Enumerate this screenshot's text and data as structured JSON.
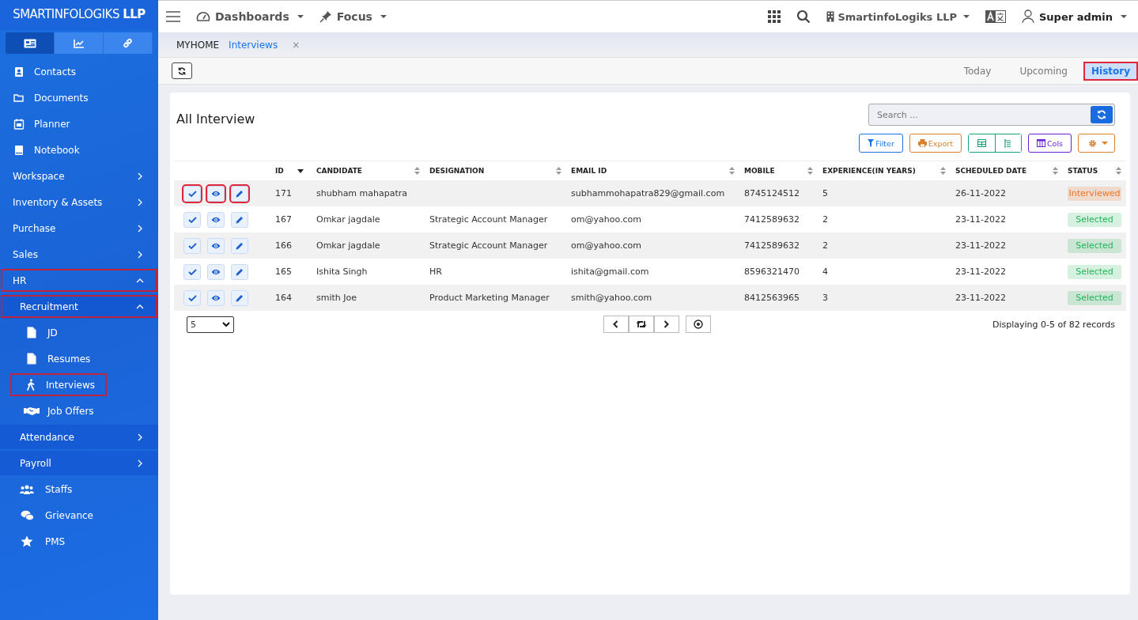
{
  "sidebar": {
    "brand": "SMARTINFOLOGIKS **LLP**",
    "tabs": [
      {
        "selected": true
      },
      {
        "selected": false
      },
      {
        "selected": false
      }
    ],
    "items": [
      {
        "kind": "link",
        "label": "Contacts",
        "highlighted": false
      },
      {
        "kind": "link",
        "label": "Documents",
        "highlighted": false
      },
      {
        "kind": "link",
        "label": "Planner",
        "highlighted": false
      },
      {
        "kind": "link",
        "label": "Notebook",
        "highlighted": false
      },
      {
        "kind": "group",
        "label": "Workspace",
        "expanded": false,
        "highlighted": false
      },
      {
        "kind": "group",
        "label": "Inventory & Assets",
        "expanded": false,
        "highlighted": false
      },
      {
        "kind": "group",
        "label": "Purchase",
        "expanded": false,
        "highlighted": false
      },
      {
        "kind": "group",
        "label": "Sales",
        "expanded": false,
        "highlighted": false
      },
      {
        "kind": "group",
        "label": "HR",
        "expanded": true,
        "highlighted": true,
        "children": [
          {
            "kind": "group",
            "label": "Recruitment",
            "expanded": true,
            "highlighted": true,
            "children": [
              {
                "kind": "link",
                "label": "JD",
                "highlighted": false
              },
              {
                "kind": "link",
                "label": "Resumes",
                "highlighted": false
              },
              {
                "kind": "link",
                "label": "Interviews",
                "highlighted": true
              },
              {
                "kind": "link",
                "label": "Job Offers",
                "highlighted": false
              }
            ]
          },
          {
            "kind": "group",
            "label": "Attendance",
            "expanded": false,
            "highlighted": false
          },
          {
            "kind": "group",
            "label": "Payroll",
            "expanded": false,
            "highlighted": false
          },
          {
            "kind": "link",
            "label": "Staffs",
            "highlighted": false
          },
          {
            "kind": "link",
            "label": "Grievance",
            "highlighted": false
          },
          {
            "kind": "link",
            "label": "PMS",
            "highlighted": false
          }
        ]
      }
    ]
  },
  "topbar": {
    "menus": [
      "Dashboards",
      "Focus"
    ],
    "company": "SmartinfoLogiks LLP",
    "user": "Super admin"
  },
  "breadcrumbs": [
    {
      "label": "MYHOME",
      "selected": false,
      "closable": false
    },
    {
      "label": "Interviews",
      "selected": true,
      "closable": true
    }
  ],
  "close_mark": "×",
  "view_tabs": [
    {
      "label": "Today",
      "selected": false
    },
    {
      "label": "Upcoming",
      "selected": false
    },
    {
      "label": "History",
      "selected": true
    }
  ],
  "panel": {
    "title": "All Interview",
    "search": {
      "placeholder": "Search ..."
    },
    "buttons": [
      {
        "kind": "filter",
        "label": "Filter"
      },
      {
        "kind": "export",
        "label": "Export"
      },
      {
        "kind": "views"
      },
      {
        "kind": "cols",
        "label": "Cols"
      },
      {
        "kind": "settings"
      }
    ]
  },
  "table": {
    "columns": [
      {
        "label": "ID",
        "sorted": true
      },
      {
        "label": "CANDIDATE",
        "sorted": false
      },
      {
        "label": "DESIGNATION",
        "sorted": false
      },
      {
        "label": "EMAIL ID",
        "sorted": false
      },
      {
        "label": "MOBILE",
        "sorted": false
      },
      {
        "label": "EXPERIENCE(IN YEARS)",
        "sorted": false
      },
      {
        "label": "SCHEDULED DATE",
        "sorted": false
      },
      {
        "label": "STATUS",
        "sorted": false
      }
    ],
    "rows": [
      {
        "highlighted": true,
        "cells": [
          "171",
          "shubham mahapatra",
          "",
          "subhammohapatra829@gmail.com",
          "8745124512",
          "5",
          "26-11-2022"
        ],
        "status": "Interviewed",
        "color": "#e8772a"
      },
      {
        "highlighted": false,
        "cells": [
          "167",
          "Omkar jagdale",
          "Strategic Account Manager",
          "om@yahoo.com",
          "7412589632",
          "2",
          "23-11-2022"
        ],
        "status": "Selected",
        "color": "#22b45a"
      },
      {
        "highlighted": false,
        "cells": [
          "166",
          "Omkar jagdale",
          "Strategic Account Manager",
          "om@yahoo.com",
          "7412589632",
          "2",
          "23-11-2022"
        ],
        "status": "Selected",
        "color": "#22b45a"
      },
      {
        "highlighted": false,
        "cells": [
          "165",
          "Ishita Singh",
          "HR",
          "ishita@gmail.com",
          "8596321470",
          "4",
          "23-11-2022"
        ],
        "status": "Selected",
        "color": "#22b45a"
      },
      {
        "highlighted": false,
        "cells": [
          "164",
          "smith Joe",
          "Product Marketing Manager",
          "smith@yahoo.com",
          "8412563965",
          "3",
          "23-11-2022"
        ],
        "status": "Selected",
        "color": "#22b45a"
      }
    ]
  },
  "footer": {
    "page_size": "5",
    "records": "Displaying 0-5 of 82 records"
  }
}
